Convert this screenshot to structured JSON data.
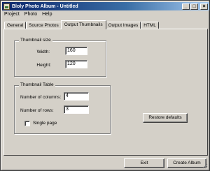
{
  "window": {
    "title": "Bloly Photo Album - Untitled"
  },
  "menu": [
    {
      "label": "Project"
    },
    {
      "label": "Photo"
    },
    {
      "label": "Help"
    }
  ],
  "tabs": [
    {
      "label": "General"
    },
    {
      "label": "Source Photos"
    },
    {
      "label": "Output Thumbnails",
      "active": true
    },
    {
      "label": "Output Images"
    },
    {
      "label": "HTML"
    }
  ],
  "thumbnail_size": {
    "legend": "Thumbnail size",
    "width_label": "Width:",
    "width_value": "160",
    "height_label": "Height:",
    "height_value": "120"
  },
  "thumbnail_table": {
    "legend": "Thumbnail Table",
    "columns_label": "Number of columns:",
    "columns_value": "4",
    "rows_label": "Number of rows:",
    "rows_value": "3",
    "single_page_label": "Single page",
    "single_page_checked": false
  },
  "buttons": {
    "restore_defaults": "Restore defaults",
    "exit": "Exit",
    "create_album": "Create Album"
  },
  "title_buttons": {
    "minimize": "_",
    "maximize": "□",
    "close": "×"
  }
}
